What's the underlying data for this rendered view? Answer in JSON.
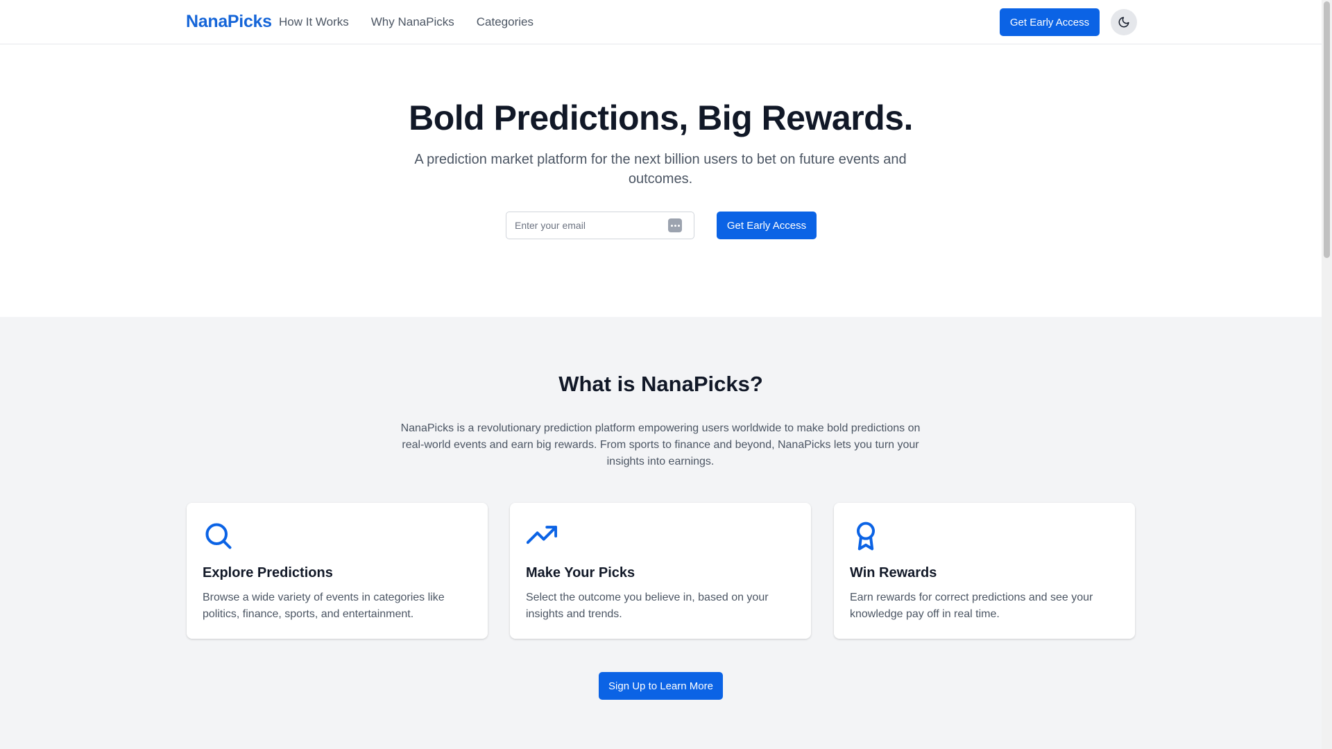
{
  "brand": {
    "name": "NanaPicks",
    "accent": "#0b63e5",
    "logo_color": "#1565d8"
  },
  "header": {
    "nav": [
      "How It Works",
      "Why NanaPicks",
      "Categories"
    ],
    "cta_label": "Get Early Access",
    "theme_icon": "moon-icon"
  },
  "hero": {
    "title": "Bold Predictions, Big Rewards.",
    "subtitle": "A prediction market platform for the next billion users to bet on future events and outcomes.",
    "email_placeholder": "Enter your email",
    "cta_label": "Get Early Access"
  },
  "about": {
    "title": "What is NanaPicks?",
    "description": "NanaPicks is a revolutionary prediction platform empowering users worldwide to make bold predictions on real-world events and earn big rewards. From sports to finance and beyond, NanaPicks lets you turn your insights into earnings.",
    "cards": [
      {
        "icon": "search-icon",
        "title": "Explore Predictions",
        "text": "Browse a wide variety of events in categories like politics, finance, sports, and entertainment."
      },
      {
        "icon": "trending-up-icon",
        "title": "Make Your Picks",
        "text": "Select the outcome you believe in, based on your insights and trends."
      },
      {
        "icon": "award-icon",
        "title": "Win Rewards",
        "text": "Earn rewards for correct predictions and see your knowledge pay off in real time."
      }
    ],
    "cta_label": "Sign Up to Learn More"
  }
}
